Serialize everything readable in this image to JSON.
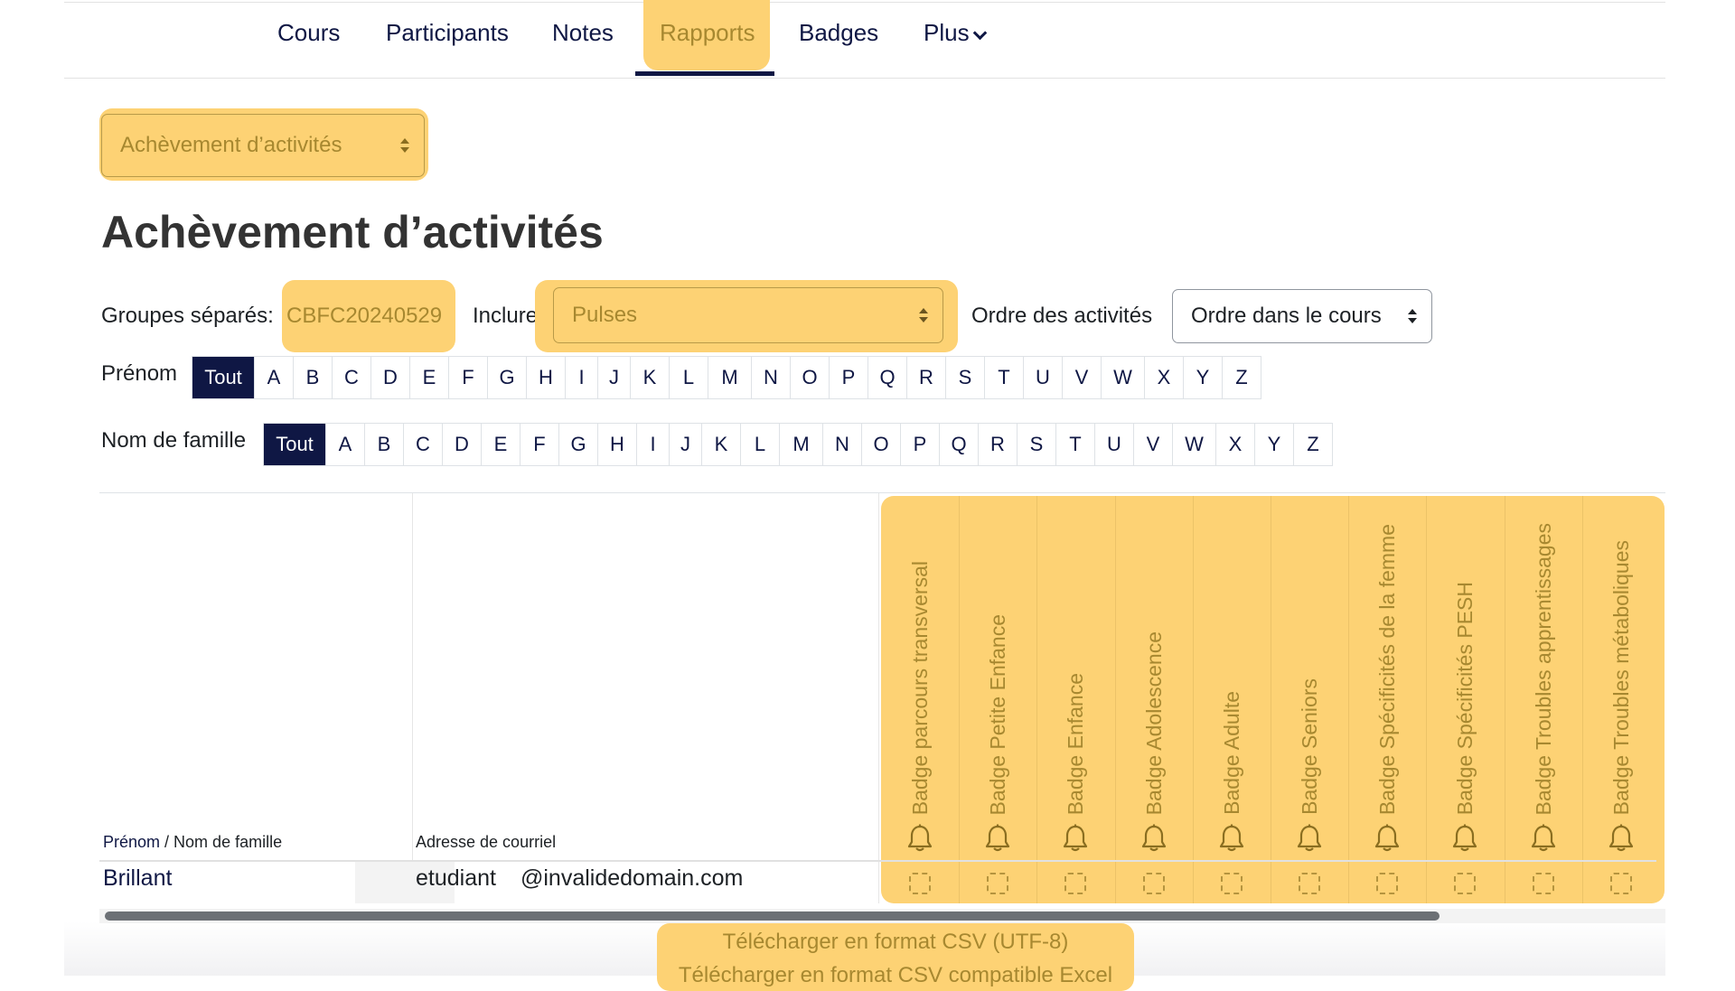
{
  "nav": {
    "items": [
      "Cours",
      "Participants",
      "Notes",
      "Rapports",
      "Badges",
      "Plus"
    ],
    "active": "Rapports"
  },
  "report_select": {
    "value": "Achèvement d’activités"
  },
  "page_title": "Achèvement d’activités",
  "filters": {
    "groups_label": "Groupes séparés:",
    "group_value": "CBFC20240529",
    "include_label": "Inclure",
    "include_value": "Pulses",
    "order_label": "Ordre des activités",
    "order_value": "Ordre dans le cours"
  },
  "initials": {
    "firstname_label": "Prénom",
    "lastname_label": "Nom de famille",
    "all_label": "Tout",
    "letters": [
      "A",
      "B",
      "C",
      "D",
      "E",
      "F",
      "G",
      "H",
      "I",
      "J",
      "K",
      "L",
      "M",
      "N",
      "O",
      "P",
      "Q",
      "R",
      "S",
      "T",
      "U",
      "V",
      "W",
      "X",
      "Y",
      "Z"
    ]
  },
  "table": {
    "header_firstname": "Prénom",
    "header_separator": " / ",
    "header_lastname": "Nom de famille",
    "header_email": "Adresse de courriel",
    "badges": [
      "Badge parcours transversal",
      "Badge Petite Enfance",
      "Badge Enfance",
      "Badge Adolescence",
      "Badge Adulte",
      "Badge Seniors",
      "Badge Spécificités de la femme",
      "Badge Spécificités PESH",
      "Badge Troubles apprentissages",
      "Badge Troubles métaboliques"
    ],
    "rows": [
      {
        "firstname": "Brillant",
        "email_user": "etudiant",
        "email_domain": "@invalidedomain.com"
      }
    ]
  },
  "downloads": {
    "csv_utf8": "Télécharger en format CSV (UTF-8)",
    "csv_excel": "Télécharger en format CSV compatible Excel"
  },
  "colors": {
    "navy": "#0f1744",
    "highlight": "#fdd274",
    "highlight_text": "#a78830"
  }
}
